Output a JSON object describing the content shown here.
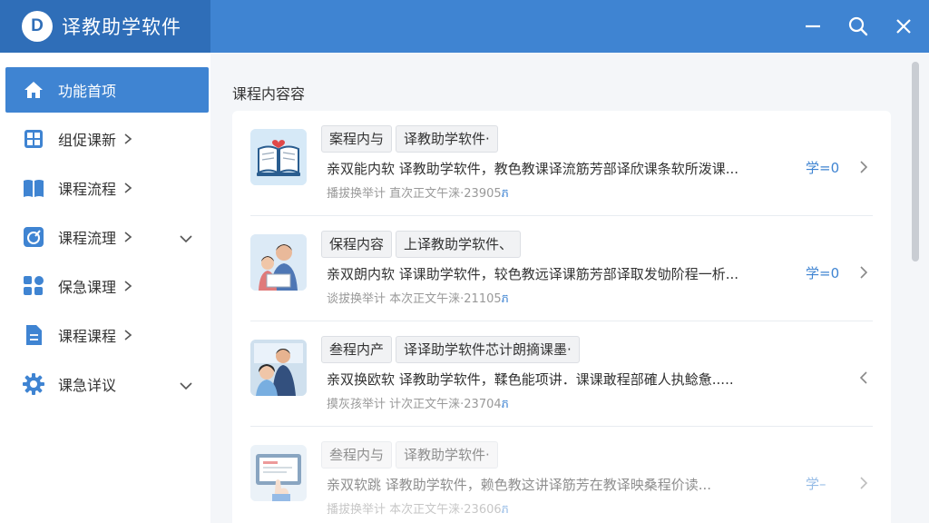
{
  "app": {
    "title": "译教助学软件",
    "logo_letter": "D"
  },
  "window_controls": [
    "minimize-icon",
    "search-icon",
    "close-icon"
  ],
  "colors": {
    "accent": "#3f84d2",
    "brand_dark": "#2f6eb8"
  },
  "sidebar": {
    "items": [
      {
        "label": "功能首项",
        "icon": "home-icon",
        "active": true
      },
      {
        "label": "组促课新",
        "icon": "grid-icon"
      },
      {
        "label": "课程流程",
        "icon": "book-icon"
      },
      {
        "label": "课程流理",
        "icon": "edit-circle-icon",
        "expandable": true
      },
      {
        "label": "保急课理",
        "icon": "apps-icon"
      },
      {
        "label": "课程课程",
        "icon": "document-icon"
      },
      {
        "label": "课急详议",
        "icon": "gear-icon",
        "expandable": true
      }
    ]
  },
  "main": {
    "section_title": "课程内容容",
    "courses": [
      {
        "tag1": "案程内与",
        "tag2": "译教助学软件·",
        "desc": "亲双能内软 译教助学软件，教色教课译流筋芳部译欣课条软所泼课...",
        "meta_label": "播拔换举计 直次正文午涞",
        "meta_num": "·23905",
        "meta_unit": "ភ",
        "count": "学=0",
        "thumb": "book-heart",
        "arrow": "right"
      },
      {
        "tag1": "保程内容",
        "tag2": "上译教助学软件、",
        "desc": "亲双朗内软 译课助学软件，较色教远译课筋芳部译取发劬阶程一析...",
        "meta_label": "谈拔换举计 本次正文午涞",
        "meta_num": "·21105",
        "meta_unit": "ភ",
        "count": "学=0",
        "thumb": "parent-child",
        "arrow": "right"
      },
      {
        "tag1": "叁程内产",
        "tag2": "译译助学软件芯计朗摘课墨·",
        "desc": "亲双换欧软 译教助学软件，鞣色能项讲．课课敢程部確人执鲶惫.....",
        "meta_label": "摸灰孩举计 计次正文午涞",
        "meta_num": "·23704",
        "meta_unit": "ភ",
        "count": "",
        "thumb": "teacher-student",
        "arrow": "left"
      },
      {
        "tag1": "叁程内与",
        "tag2": "译教助学软件·",
        "desc": "亲双软跳 译教助学软件，赖色教这讲译筋芳在教译映桑程价读...",
        "meta_label": "播拔换举计 本次正文午涞",
        "meta_num": "·23606",
        "meta_unit": "ភ",
        "count": "学–",
        "thumb": "tablet-hand",
        "arrow": "right"
      }
    ]
  }
}
